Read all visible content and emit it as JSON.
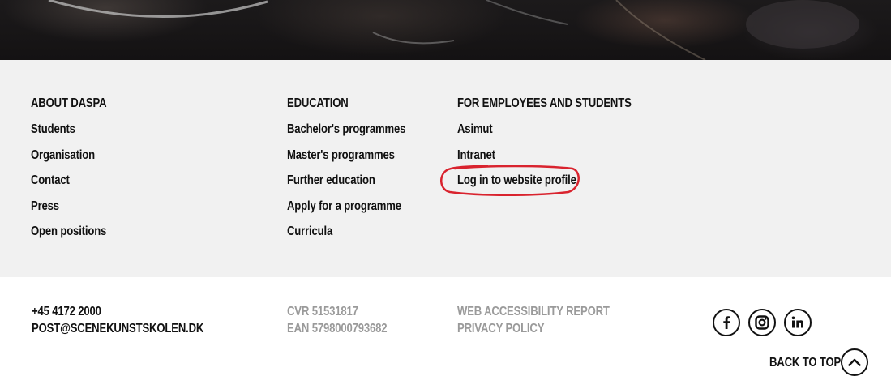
{
  "hero": {
    "image": "performance-photo"
  },
  "columns": [
    {
      "heading": "ABOUT DASPA",
      "links": [
        "Students",
        "Organisation",
        "Contact",
        "Press",
        "Open positions"
      ]
    },
    {
      "heading": "EDUCATION",
      "links": [
        "Bachelor's programmes",
        "Master's programmes",
        "Further education",
        "Apply for a programme",
        "Curricula"
      ]
    },
    {
      "heading": "FOR EMPLOYEES AND STUDENTS",
      "links": [
        "Asimut",
        "Intranet",
        "Log in to website profile"
      ]
    }
  ],
  "highlight": {
    "target": "Log in to website profile",
    "color": "#d9232e"
  },
  "contact": {
    "phone": "+45 4172 2000",
    "email": "POST@SCENEKUNSTSKOLEN.DK"
  },
  "registry": {
    "cvr": "CVR 51531817",
    "ean": "EAN 5798000793682"
  },
  "legal": {
    "accessibility": "WEB ACCESSIBILITY REPORT",
    "privacy": "PRIVACY POLICY"
  },
  "social": [
    "facebook-icon",
    "instagram-icon",
    "linkedin-icon"
  ],
  "back_to_top": "BACK TO TOP",
  "colors": {
    "footer_bg": "#f1f1f1",
    "text": "#111111",
    "muted": "#9a9a9a"
  }
}
